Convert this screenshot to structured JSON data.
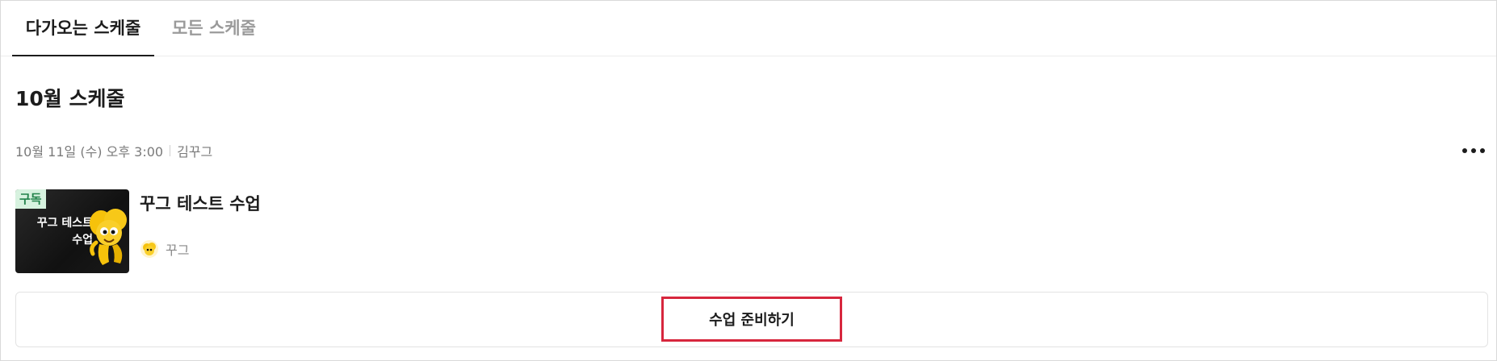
{
  "tabs": {
    "upcoming_label": "다가오는 스케줄",
    "all_label": "모든 스케줄",
    "active": "upcoming"
  },
  "month": {
    "title": "10월 스케줄"
  },
  "schedule_item": {
    "datetime": "10월 11일 (수) 오후 3:00",
    "host": "김꾸그",
    "thumbnail": {
      "badge": "구독",
      "title": "꾸그 테스트\n수업",
      "character_icon": "yellow-mascot-icon"
    },
    "class_title": "꾸그 테스트 수업",
    "teacher_name": "꾸그",
    "more_icon": "more-horizontal-icon"
  },
  "actions": {
    "prepare_label": "수업 준비하기",
    "highlight_color": "#d7263d"
  },
  "colors": {
    "badge_bg": "#d7f2df",
    "badge_text": "#22824a",
    "active_tab": "#1c1c1c",
    "inactive_tab": "#9a9a9a"
  }
}
